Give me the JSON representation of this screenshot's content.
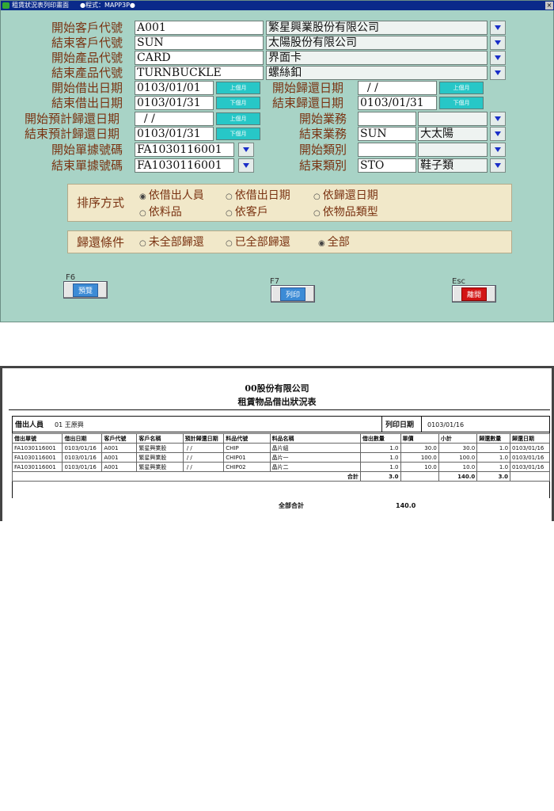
{
  "window": {
    "title": "租賃狀況表列印畫面",
    "program": "●程式：MAPP3P●",
    "close": "×"
  },
  "form": {
    "customer_start": {
      "label": "開始客戶代號",
      "code": "A001",
      "name": "繁星興業股份有限公司"
    },
    "customer_end": {
      "label": "結束客戶代號",
      "code": "SUN",
      "name": "太陽股份有限公司"
    },
    "product_start": {
      "label": "開始產品代號",
      "code": "CARD",
      "name": "界面卡"
    },
    "product_end": {
      "label": "結束產品代號",
      "code": "TURNBUCKLE",
      "name": "螺絲釦"
    },
    "lend_start": {
      "label": "開始借出日期",
      "value": "0103/01/01",
      "btn": "上個月"
    },
    "lend_end": {
      "label": "結束借出日期",
      "value": "0103/01/31",
      "btn": "下個月"
    },
    "plan_start": {
      "label": "開始預計歸還日期",
      "value": "  / /",
      "btn": "上個月"
    },
    "plan_end": {
      "label": "結束預計歸還日期",
      "value": "0103/01/31",
      "btn": "下個月"
    },
    "doc_start": {
      "label": "開始單據號碼",
      "value": "FA1030116001"
    },
    "doc_end": {
      "label": "結束單據號碼",
      "value": "FA1030116001"
    },
    "return_start": {
      "label": "開始歸還日期",
      "value": "  / /",
      "btn": "上個月"
    },
    "return_end": {
      "label": "結束歸還日期",
      "value": "0103/01/31",
      "btn": "下個月"
    },
    "sales_start": {
      "label": "開始業務",
      "code": "",
      "name": ""
    },
    "sales_end": {
      "label": "結束業務",
      "code": "SUN",
      "name": "大太陽"
    },
    "cat_start": {
      "label": "開始類別",
      "code": "",
      "name": ""
    },
    "cat_end": {
      "label": "結束類別",
      "code": "STO",
      "name": "鞋子類"
    }
  },
  "sort": {
    "label": "排序方式",
    "options": [
      "依借出人員",
      "依借出日期",
      "依歸還日期",
      "依料品",
      "依客戶",
      "依物品類型"
    ],
    "selected": "依借出人員"
  },
  "return_cond": {
    "label": "歸還條件",
    "options": [
      "未全部歸還",
      "已全部歸還",
      "全部"
    ],
    "selected": "全部"
  },
  "buttons": {
    "preview": {
      "key": "F6",
      "label": "預覽"
    },
    "print": {
      "key": "F7",
      "label": "列印"
    },
    "exit": {
      "key": "Esc",
      "label": "離開"
    }
  },
  "report": {
    "company": "00股份有限公司",
    "title": "租賃物品借出狀況表",
    "lender_label": "借出人員",
    "lender_value": "01 王原興",
    "print_date_label": "列印日期",
    "print_date_value": "0103/01/16",
    "headers": [
      "借出單號",
      "借出日期",
      "客戶代號",
      "客戶名稱",
      "預計歸還日期",
      "料品代號",
      "料品名稱",
      "借出數量",
      "單價",
      "小計",
      "歸還數量",
      "歸還日期"
    ],
    "rows": [
      [
        "FA1030116001",
        "0103/01/16",
        "A001",
        "繁星興業股",
        " / /",
        "CHIP",
        "晶片組",
        "1.0",
        "30.0",
        "30.0",
        "1.0",
        "0103/01/16"
      ],
      [
        "FA1030116001",
        "0103/01/16",
        "A001",
        "繁星興業股",
        " / /",
        "CHIP01",
        "晶片一",
        "1.0",
        "100.0",
        "100.0",
        "1.0",
        "0103/01/16"
      ],
      [
        "FA1030116001",
        "0103/01/16",
        "A001",
        "繁星興業股",
        " / /",
        "CHIP02",
        "晶片二",
        "1.0",
        "10.0",
        "10.0",
        "1.0",
        "0103/01/16"
      ]
    ],
    "subtotal_label": "合計",
    "subtotal_qty": "3.0",
    "subtotal_amount": "140.0",
    "subtotal_return": "3.0",
    "grand_label": "全部合計",
    "grand_amount": "140.0"
  }
}
